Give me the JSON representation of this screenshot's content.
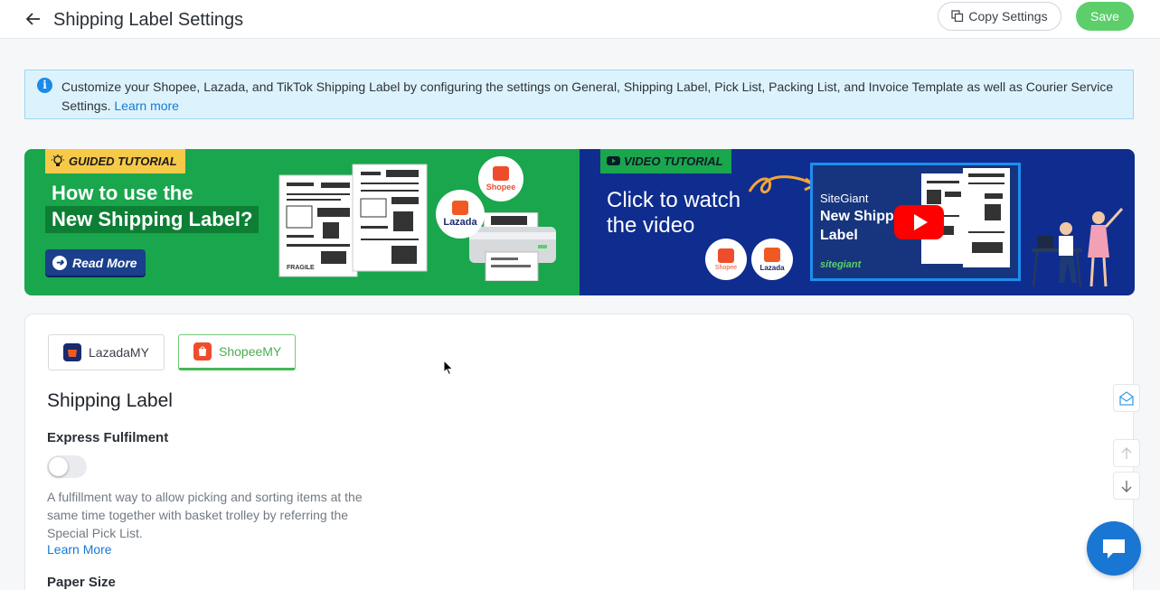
{
  "header": {
    "title": "Shipping Label Settings",
    "copy_label": "Copy Settings",
    "save_label": "Save"
  },
  "info": {
    "text": "Customize your Shopee, Lazada, and TikTok Shipping Label by configuring the settings on General, Shipping Label, Pick List, Packing List, and Invoice Template as well as Courier Service Settings.",
    "link": "Learn more"
  },
  "banner_guided": {
    "tag": "GUIDED TUTORIAL",
    "line1": "How to use the",
    "line2": "New Shipping Label?",
    "button": "Read More",
    "lazada": "Lazada",
    "shopee": "Shopee"
  },
  "banner_video": {
    "tag": "VIDEO TUTORIAL",
    "line1": "Click to watch",
    "line2": "the video",
    "screen_brand": "SiteGiant",
    "screen_line1": "New Shipp",
    "screen_line2": "Label",
    "shopee": "Shopee",
    "lazada": "Lazada",
    "brand_logo": "sitegiant"
  },
  "tabs": [
    {
      "label": "LazadaMY",
      "active": false
    },
    {
      "label": "ShopeeMY",
      "active": true
    }
  ],
  "section": {
    "title": "Shipping Label",
    "express_label": "Express Fulfilment",
    "express_on": false,
    "express_desc": "A fulfillment way to allow picking and sorting items at the same time together with basket trolley by referring the Special Pick List.",
    "learn_more": "Learn More",
    "paper_label": "Paper Size"
  },
  "colors": {
    "save": "#5ccf6b",
    "accent_link": "#1679d6",
    "banner_green": "#19a64c",
    "banner_blue": "#0f2d8f",
    "info_bg": "#dcf3fd",
    "chat": "#1976d2"
  },
  "icons": [
    "back-arrow-icon",
    "copy-icon",
    "info-icon",
    "bulb-icon",
    "youtube-icon",
    "arrow-right-circle-icon",
    "play-icon",
    "mail-icon",
    "arrow-up-icon",
    "arrow-down-icon",
    "chat-icon"
  ]
}
